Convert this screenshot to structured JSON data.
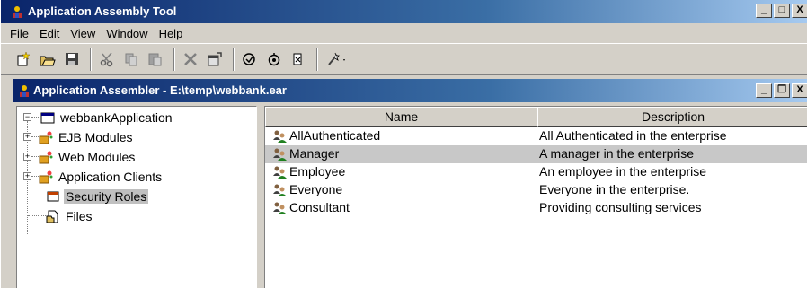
{
  "window": {
    "title": "Application Assembly Tool",
    "buttons": [
      "_",
      "□",
      "X"
    ]
  },
  "menubar": {
    "items": [
      {
        "label": "File"
      },
      {
        "label": "Edit"
      },
      {
        "label": "View"
      },
      {
        "label": "Window"
      },
      {
        "label": "Help"
      }
    ]
  },
  "toolbar": {
    "buttons": [
      {
        "icon": "new-icon"
      },
      {
        "icon": "open-icon"
      },
      {
        "icon": "save-icon"
      },
      {
        "icon": "cut-icon"
      },
      {
        "icon": "copy-icon"
      },
      {
        "icon": "paste-icon"
      },
      {
        "icon": "delete-icon"
      },
      {
        "icon": "properties-icon"
      },
      {
        "icon": "verify-icon"
      },
      {
        "icon": "generate-icon"
      },
      {
        "icon": "deploy-icon"
      },
      {
        "icon": "wizard-icon"
      }
    ]
  },
  "inner_window": {
    "title": "Application Assembler - E:\\temp\\webbank.ear",
    "buttons": [
      "_",
      "❐",
      "X"
    ]
  },
  "tree": {
    "root": {
      "label": "webbankApplication"
    },
    "children": [
      {
        "label": "EJB Modules",
        "expandable": true
      },
      {
        "label": "Web Modules",
        "expandable": true
      },
      {
        "label": "Application Clients",
        "expandable": true
      },
      {
        "label": "Security Roles",
        "expandable": false,
        "selected": true
      },
      {
        "label": "Files",
        "expandable": false
      }
    ]
  },
  "table": {
    "columns": [
      "Name",
      "Description"
    ],
    "rows": [
      {
        "name": "AllAuthenticated",
        "description": "All Authenticated in the enterprise"
      },
      {
        "name": "Manager",
        "description": "A manager in the enterprise",
        "selected": true
      },
      {
        "name": "Employee",
        "description": "An employee in the enterprise"
      },
      {
        "name": "Everyone",
        "description": "Everyone in the enterprise."
      },
      {
        "name": "Consultant",
        "description": "Providing consulting services"
      }
    ]
  },
  "colors": {
    "titlebar_start": "#0a246a",
    "titlebar_end": "#a6caf0",
    "face": "#d4d0c8",
    "selection": "#c8c8c8"
  }
}
